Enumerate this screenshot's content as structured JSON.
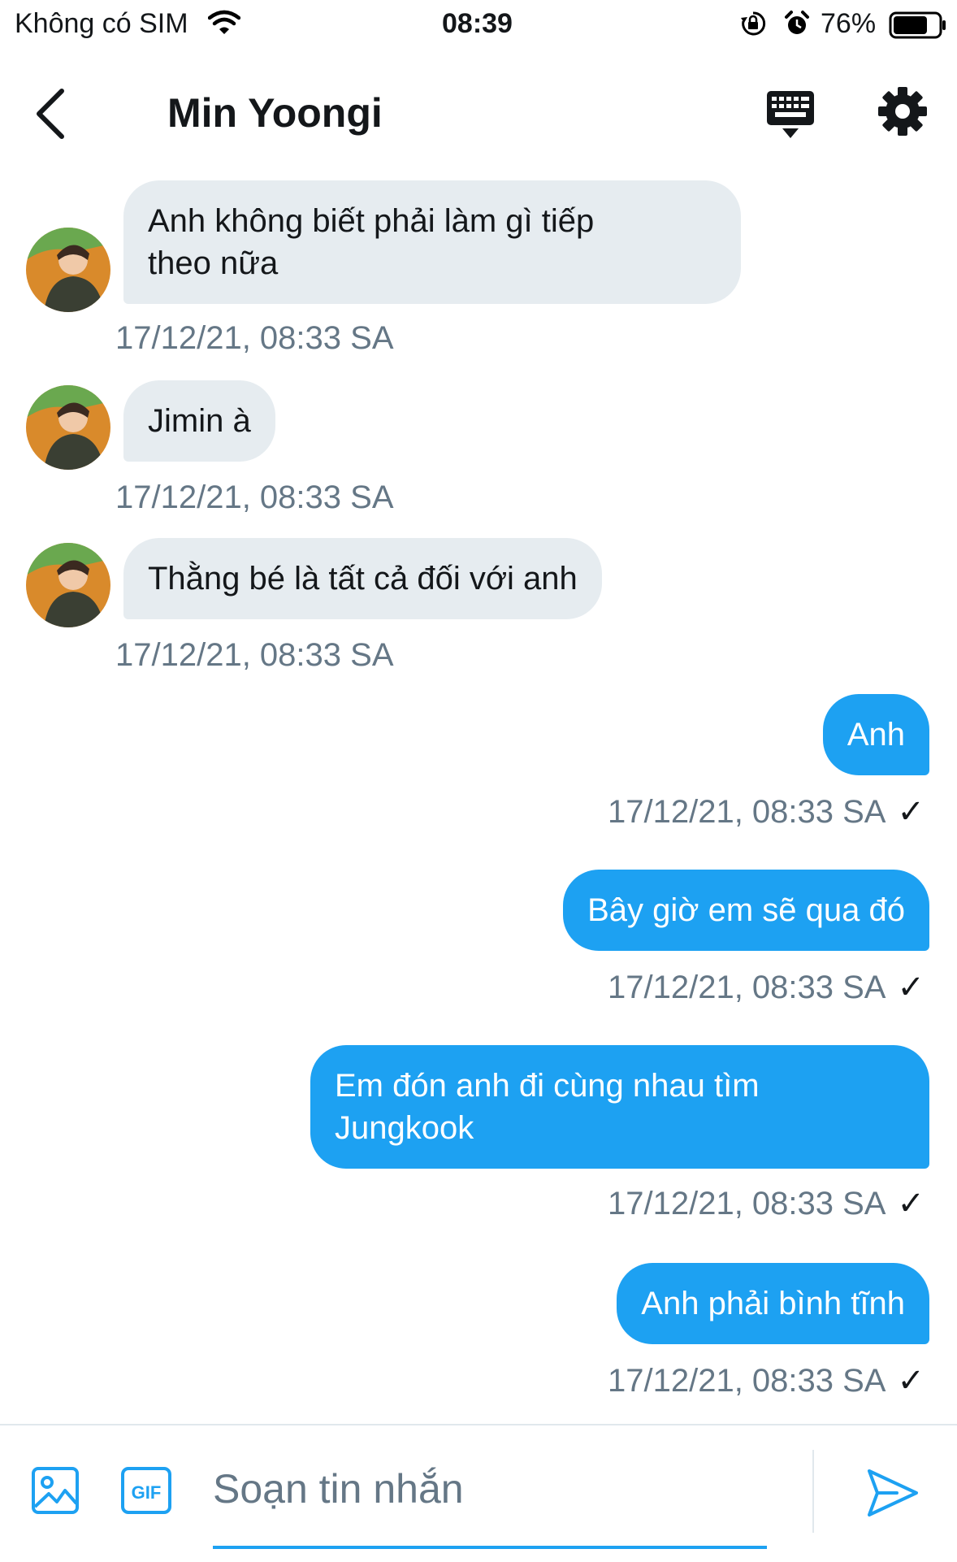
{
  "status_bar": {
    "carrier": "Không có SIM",
    "time": "08:39",
    "battery_percent": "76%",
    "battery_level": 0.76
  },
  "header": {
    "title": "Min Yoongi",
    "icons": {
      "back": "chevron-left-icon",
      "keyboard": "keyboard-icon",
      "settings": "gear-icon"
    }
  },
  "messages": [
    {
      "direction": "in",
      "text_lines": [
        "Anh không biết phải làm gì tiếp",
        "theo nữa"
      ],
      "timestamp": "17/12/21, 08:33 SA"
    },
    {
      "direction": "in",
      "text_lines": [
        "Jimin à"
      ],
      "timestamp": "17/12/21, 08:33 SA"
    },
    {
      "direction": "in",
      "text_lines": [
        "Thằng bé là tất cả đối với anh"
      ],
      "timestamp": "17/12/21, 08:33 SA"
    },
    {
      "direction": "out",
      "text_lines": [
        "Anh"
      ],
      "timestamp": "17/12/21, 08:33 SA",
      "status": "✓"
    },
    {
      "direction": "out",
      "text_lines": [
        "Bây giờ em sẽ qua đó"
      ],
      "timestamp": "17/12/21, 08:33 SA",
      "status": "✓"
    },
    {
      "direction": "out",
      "text_lines": [
        "Em đón anh đi cùng nhau tìm",
        "Jungkook"
      ],
      "timestamp": "17/12/21, 08:33 SA",
      "status": "✓"
    },
    {
      "direction": "out",
      "text_lines": [
        "Anh phải bình tĩnh"
      ],
      "timestamp": "17/12/21, 08:33 SA",
      "status": "✓"
    }
  ],
  "composer": {
    "placeholder": "Soạn tin nhắn",
    "gif_label": "GIF",
    "icons": {
      "image": "image-icon",
      "gif": "gif-icon",
      "send": "send-icon"
    }
  },
  "colors": {
    "accent": "#1da1f2",
    "incoming_bubble": "#e6ecf0",
    "timestamp": "#657786",
    "text": "#14171a"
  }
}
